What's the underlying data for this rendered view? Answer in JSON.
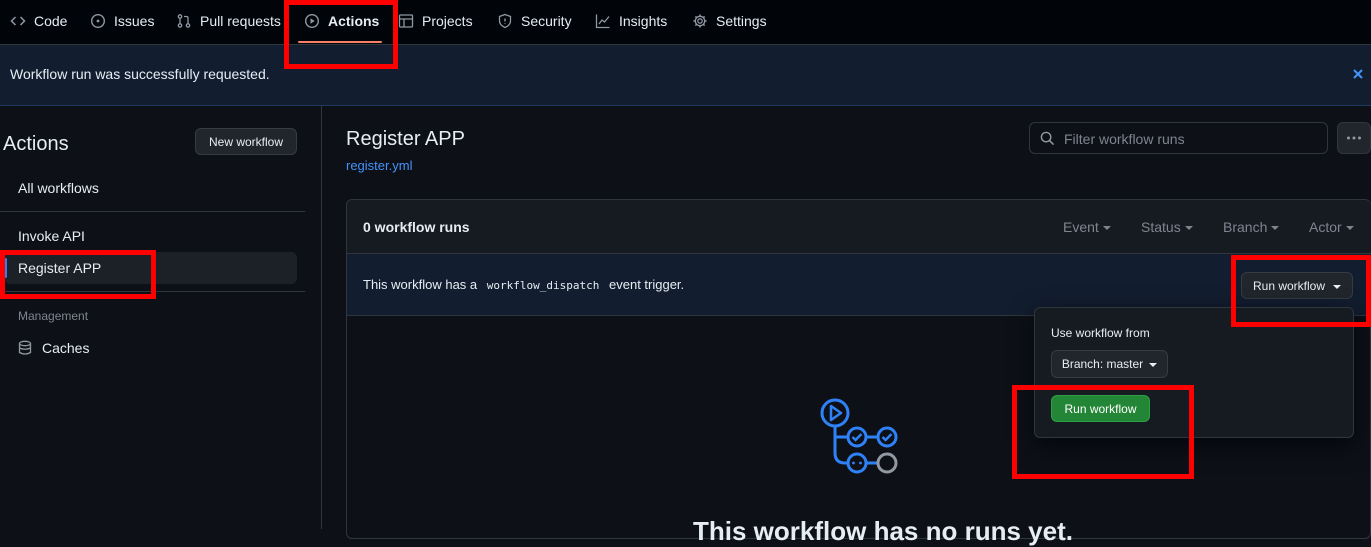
{
  "nav": {
    "tabs": [
      {
        "label": "Code",
        "icon": "code-icon"
      },
      {
        "label": "Issues",
        "icon": "issue-opened-icon"
      },
      {
        "label": "Pull requests",
        "icon": "git-pull-request-icon"
      },
      {
        "label": "Actions",
        "icon": "play-icon",
        "active": true
      },
      {
        "label": "Projects",
        "icon": "table-icon"
      },
      {
        "label": "Security",
        "icon": "shield-icon"
      },
      {
        "label": "Insights",
        "icon": "graph-icon"
      },
      {
        "label": "Settings",
        "icon": "gear-icon"
      }
    ]
  },
  "flash": {
    "message": "Workflow run was successfully requested."
  },
  "sidebar": {
    "title": "Actions",
    "new_workflow_label": "New workflow",
    "all_workflows": "All workflows",
    "workflows": [
      {
        "label": "Invoke API"
      },
      {
        "label": "Register APP",
        "selected": true
      }
    ],
    "management_heading": "Management",
    "caches_label": "Caches"
  },
  "main": {
    "title": "Register APP",
    "file_link": "register.yml",
    "search_placeholder": "Filter workflow runs",
    "runs_count": "0 workflow runs",
    "filters": [
      "Event",
      "Status",
      "Branch",
      "Actor"
    ],
    "dispatch": {
      "text_before": "This workflow has a",
      "code": "workflow_dispatch",
      "text_after": "event trigger."
    },
    "run_workflow_label": "Run workflow",
    "dropdown": {
      "use_from_label": "Use workflow from",
      "branch_label": "Branch: master",
      "run_button_label": "Run workflow"
    },
    "empty_state_heading": "This workflow has no runs yet."
  },
  "colors": {
    "accent": "#2f81f7",
    "active_underline": "#f78166",
    "primary_button": "#238636",
    "highlight": "#ff0000"
  }
}
